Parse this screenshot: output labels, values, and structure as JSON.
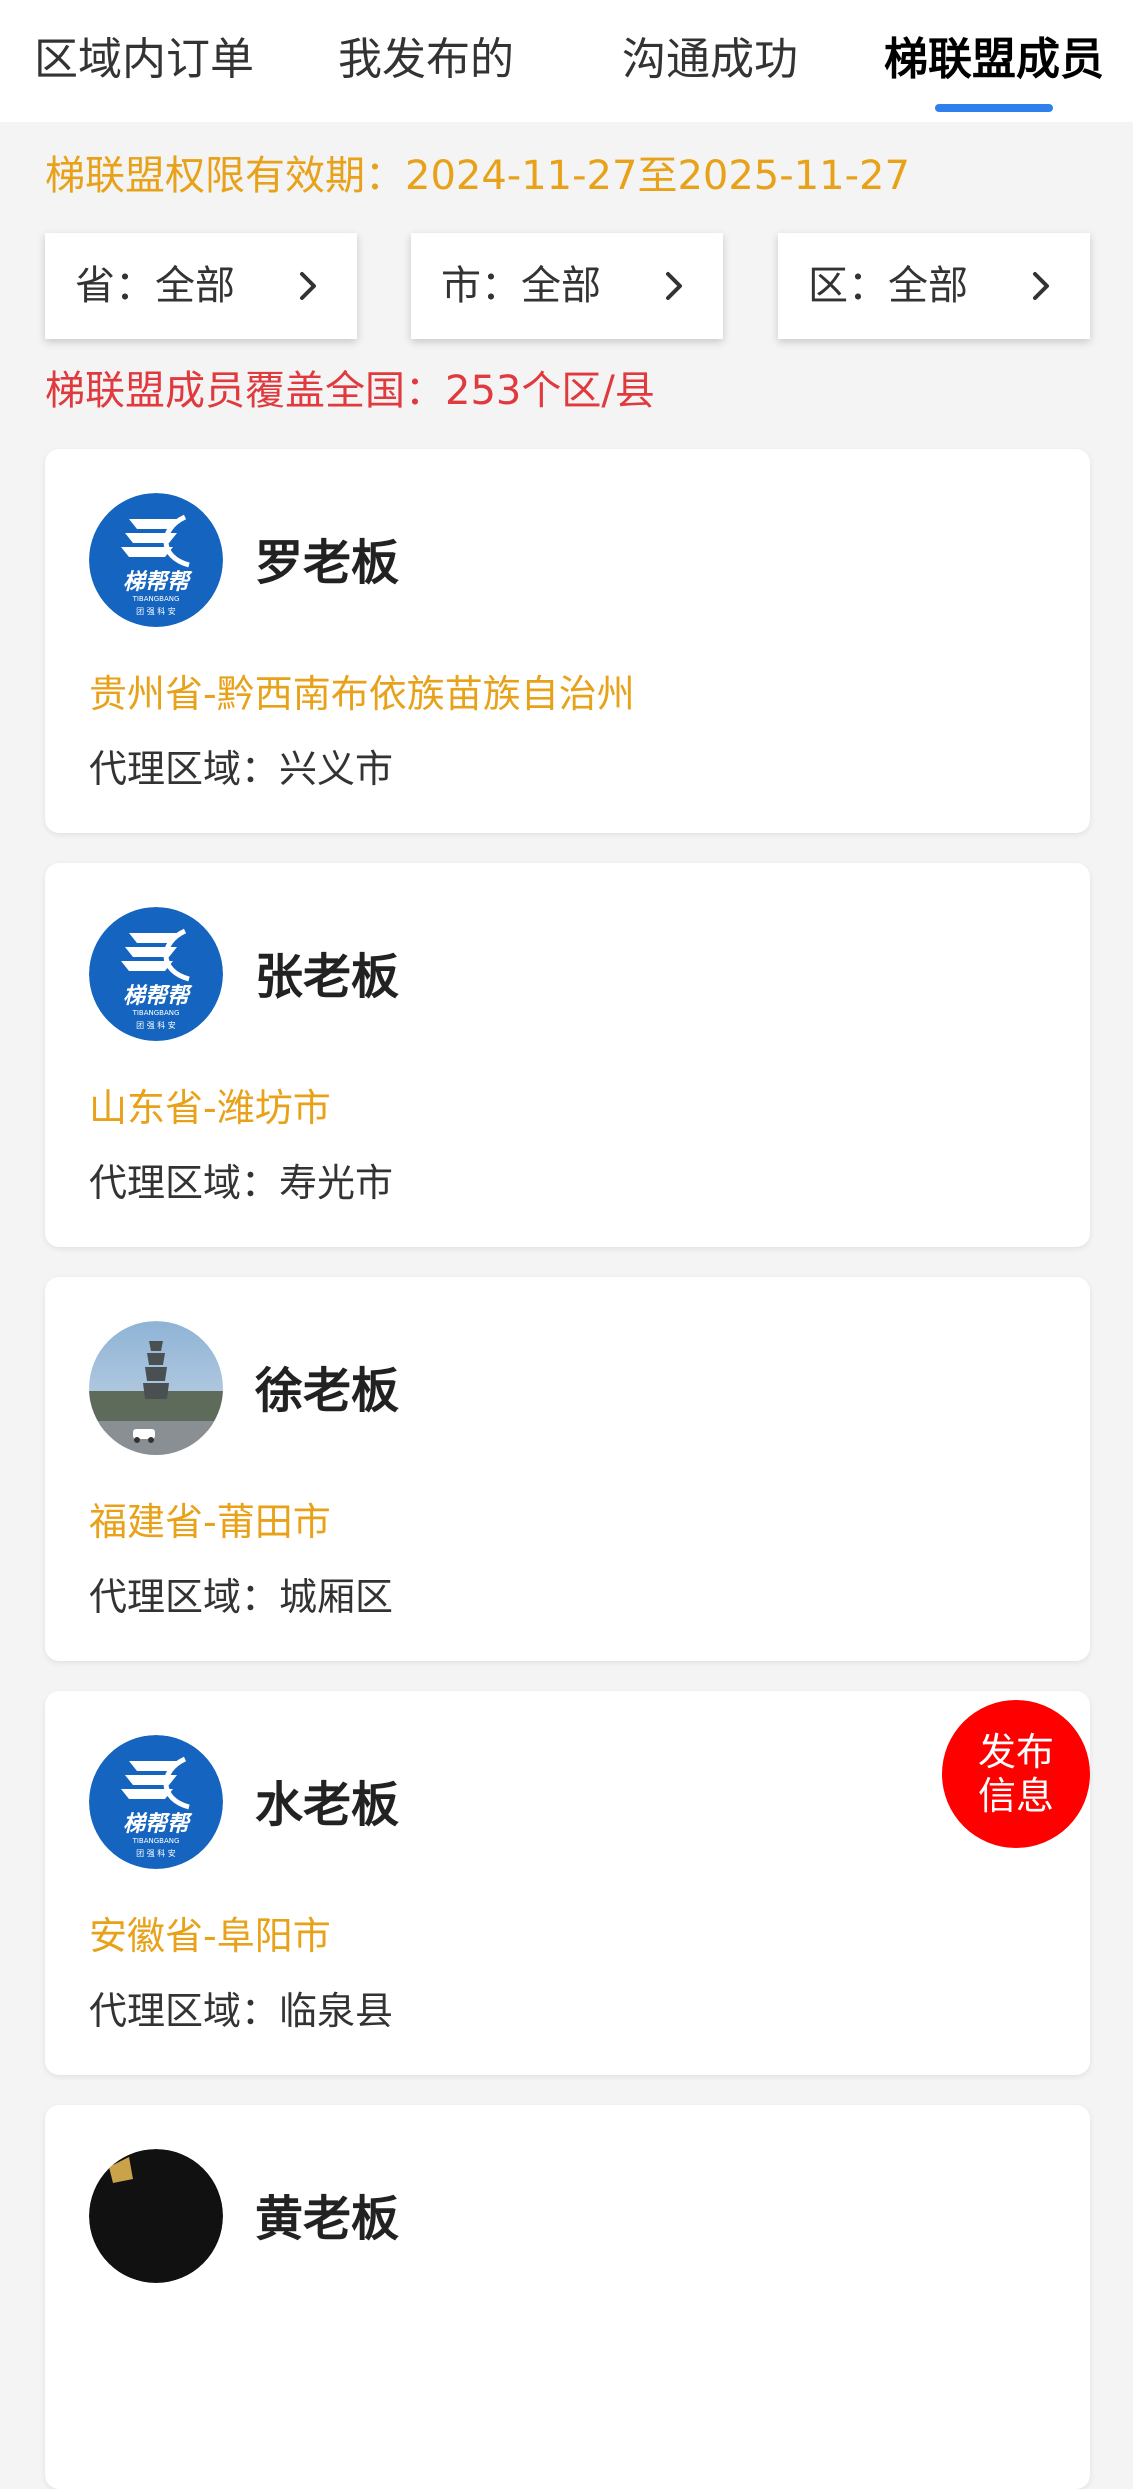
{
  "tabs": [
    {
      "label": "区域内订单",
      "active": false
    },
    {
      "label": "我发布的",
      "active": false
    },
    {
      "label": "沟通成功",
      "active": false
    },
    {
      "label": "梯联盟成员",
      "active": true
    }
  ],
  "validity_text": "梯联盟权限有效期：2024-11-27至2025-11-27",
  "filters": {
    "province": "省：全部",
    "city": "市：全部",
    "district": "区：全部"
  },
  "coverage_text": "梯联盟成员覆盖全国：253个区/县",
  "members": [
    {
      "name": "罗老板",
      "region": "贵州省-黔西南布依族苗族自治州",
      "agent_area": "代理区域：兴义市",
      "avatar": "tibangbang-logo"
    },
    {
      "name": "张老板",
      "region": "山东省-潍坊市",
      "agent_area": "代理区域：寿光市",
      "avatar": "tibangbang-logo"
    },
    {
      "name": "徐老板",
      "region": "福建省-莆田市",
      "agent_area": "代理区域：城厢区",
      "avatar": "pagoda-photo"
    },
    {
      "name": "水老板",
      "region": "安徽省-阜阳市",
      "agent_area": "代理区域：临泉县",
      "avatar": "tibangbang-logo"
    },
    {
      "name": "黄老板",
      "region": "",
      "agent_area": "",
      "avatar": "dark-avatar"
    }
  ],
  "logo": {
    "brand": "梯帮帮",
    "sub": "TIBANGBANG",
    "tag": "团 强 科 安"
  },
  "fab": {
    "line1": "发布",
    "line2": "信息"
  },
  "colors": {
    "accent_blue": "#2f80ed",
    "validity_orange": "#e8a21a",
    "coverage_red": "#e0393e",
    "region_orange": "#e8a21a",
    "fab_red": "#ff0000",
    "logo_blue": "#1565c0"
  },
  "icons": {
    "filter_chevron": "chevron-right-icon"
  }
}
